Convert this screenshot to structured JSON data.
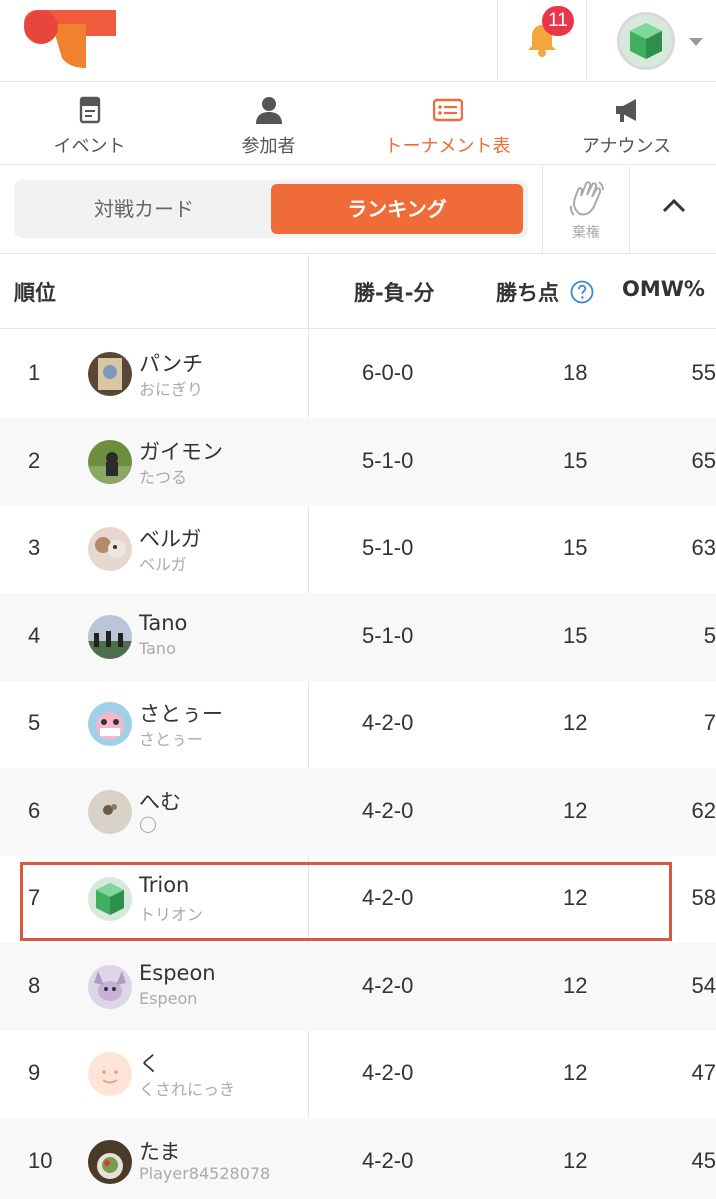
{
  "header": {
    "logo": "brand-logo",
    "notifications": {
      "count": "11",
      "icon": "bell-icon"
    },
    "colors": {
      "accent": "#ef6b37",
      "badge": "#e8374a"
    }
  },
  "nav": {
    "items": [
      {
        "label": "イベント",
        "icon": "event-doc-icon",
        "active": false
      },
      {
        "label": "参加者",
        "icon": "person-icon",
        "active": false
      },
      {
        "label": "トーナメント表",
        "icon": "bracket-list-icon",
        "active": true
      },
      {
        "label": "アナウンス",
        "icon": "megaphone-icon",
        "active": false
      }
    ]
  },
  "segment": {
    "left_label": "対戦カード",
    "right_label": "ランキング",
    "selected": "ランキング",
    "forfeit_label": "棄権"
  },
  "table": {
    "headers": {
      "rank": "順位",
      "record": "勝-負-分",
      "points": "勝ち点",
      "omw": "OMW%"
    },
    "rows": [
      {
        "rank": "1",
        "name": "パンチ",
        "sub": "おにぎり",
        "record": "6-0-0",
        "points": "18",
        "omw": "55",
        "highlighted": false
      },
      {
        "rank": "2",
        "name": "ガイモン",
        "sub": "たつる",
        "record": "5-1-0",
        "points": "15",
        "omw": "65",
        "highlighted": false
      },
      {
        "rank": "3",
        "name": "ベルガ",
        "sub": "ベルガ",
        "record": "5-1-0",
        "points": "15",
        "omw": "63",
        "highlighted": false
      },
      {
        "rank": "4",
        "name": "Tano",
        "sub": "Tano",
        "record": "5-1-0",
        "points": "15",
        "omw": "5",
        "highlighted": false
      },
      {
        "rank": "5",
        "name": "さとぅー",
        "sub": "さとぅー",
        "record": "4-2-0",
        "points": "12",
        "omw": "7",
        "highlighted": false
      },
      {
        "rank": "6",
        "name": "へむ",
        "sub": "◯",
        "record": "4-2-0",
        "points": "12",
        "omw": "62",
        "highlighted": false
      },
      {
        "rank": "7",
        "name": "Trion",
        "sub": "トリオン",
        "record": "4-2-0",
        "points": "12",
        "omw": "58",
        "highlighted": true
      },
      {
        "rank": "8",
        "name": "Espeon",
        "sub": "Espeon",
        "record": "4-2-0",
        "points": "12",
        "omw": "54",
        "highlighted": false
      },
      {
        "rank": "9",
        "name": "く",
        "sub": "くされにっき",
        "record": "4-2-0",
        "points": "12",
        "omw": "47",
        "highlighted": false
      },
      {
        "rank": "10",
        "name": "たま",
        "sub": "Player84528078",
        "record": "4-2-0",
        "points": "12",
        "omw": "45",
        "highlighted": false
      }
    ]
  }
}
